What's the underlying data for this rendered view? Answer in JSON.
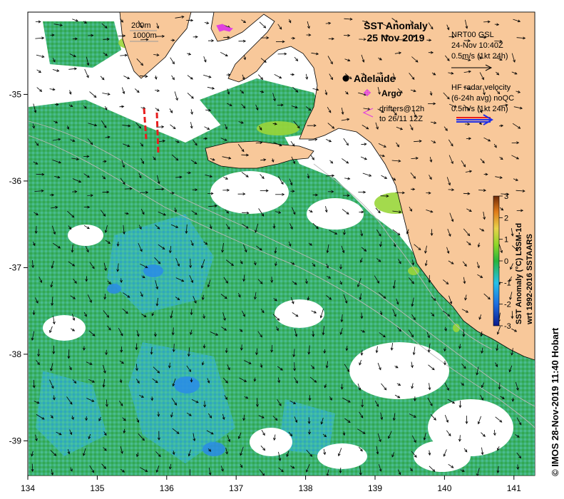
{
  "title": {
    "line1": "SST Anomaly",
    "line2": "25 Nov 2019"
  },
  "depth_legend": {
    "contour_1": "200m",
    "contour_2": "1000m"
  },
  "place_labels": {
    "city": "Adelaide",
    "argo": "Argo",
    "drifters_line1": "drifters@12h",
    "drifters_line2": "to 26/11 12Z"
  },
  "current_legend": {
    "line1": "NRT00 GSL",
    "line2": "24-Nov 10:40Z",
    "line3": "0.5m/s (1kt 24h)"
  },
  "radar_legend": {
    "line1": "HF radar velocity",
    "line2": "(6-24h avg) noQC",
    "line3": "0.5m/s (1kt 24h)"
  },
  "colorbar": {
    "label_line1": "SST Anomaly (°C) L3SM-1d",
    "label_line2": "wrt 1992-2016 SSTAARS",
    "ticks": [
      "3",
      "2",
      "1",
      "0",
      "-1",
      "-2",
      "-3"
    ],
    "range": [
      -3,
      3
    ],
    "colors": [
      "#0a1a8c",
      "#1f6fe0",
      "#28c0e8",
      "#28b43c",
      "#8cd628",
      "#e8d24a",
      "#e07a18",
      "#6e2a08"
    ]
  },
  "x_axis": {
    "ticks": [
      "134",
      "135",
      "136",
      "137",
      "138",
      "139",
      "140",
      "141"
    ],
    "range": [
      134,
      141.3
    ]
  },
  "y_axis": {
    "ticks": [
      "-35",
      "-36",
      "-37",
      "-38",
      "-39"
    ],
    "range": [
      -39.4,
      -34.05
    ]
  },
  "credit": "© IMOS 28-Nov-2019 11:40 Hobart",
  "colors": {
    "land": "#f8c89a",
    "ocean_cool": "#3cb4a4",
    "ocean_warm": "#28a850",
    "argo": "#e040e0",
    "drifter": "#e81e1e"
  }
}
